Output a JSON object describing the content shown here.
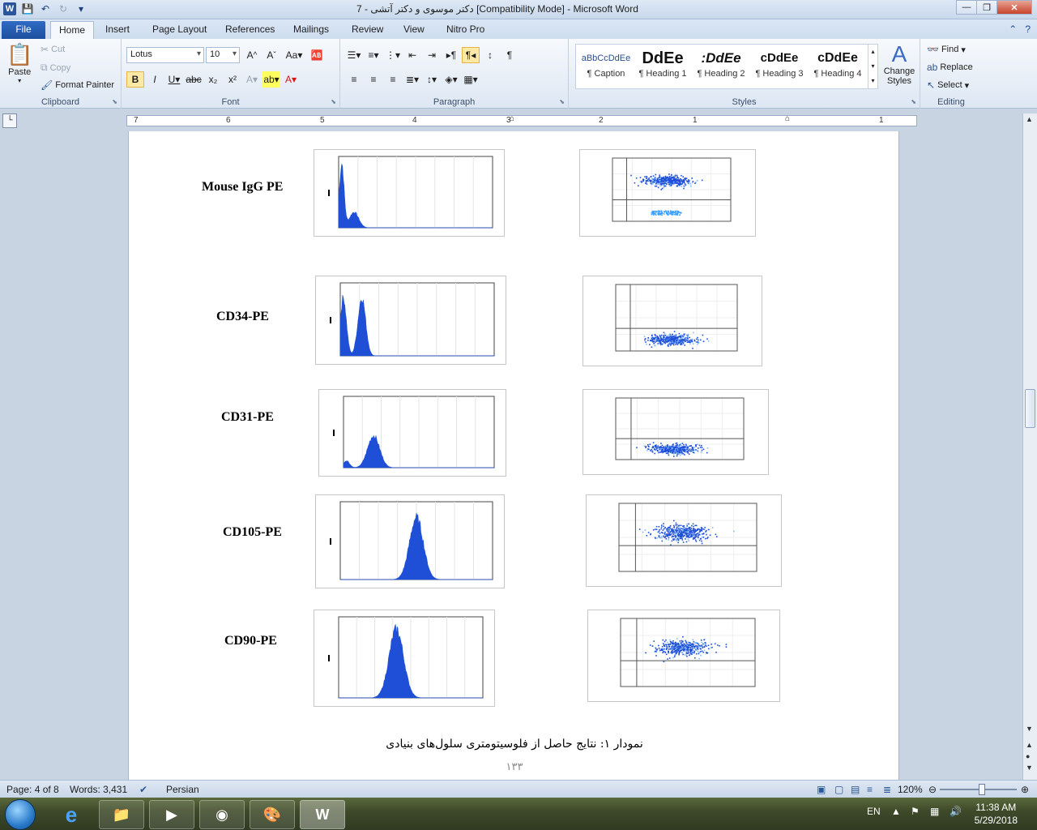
{
  "window": {
    "title": "دکتر موسوی و دکتر آتشی - 7 [Compatibility Mode] - Microsoft Word"
  },
  "quick_access": {
    "icons": [
      "word-logo",
      "save-icon",
      "undo-icon",
      "redo-icon",
      "customize-icon"
    ]
  },
  "tabs": [
    "File",
    "Home",
    "Insert",
    "Page Layout",
    "References",
    "Mailings",
    "Review",
    "View",
    "Nitro Pro"
  ],
  "active_tab": "Home",
  "clipboard": {
    "paste": "Paste",
    "cut": "Cut",
    "copy": "Copy",
    "format_painter": "Format Painter",
    "label": "Clipboard"
  },
  "font": {
    "name": "Lotus",
    "size": "10",
    "label": "Font"
  },
  "paragraph": {
    "label": "Paragraph"
  },
  "styles": {
    "label": "Styles",
    "items": [
      {
        "preview": "aBbCcDdEe",
        "name": "¶ Caption"
      },
      {
        "preview": "DdEe",
        "name": "¶ Heading 1"
      },
      {
        "preview": ":DdEe",
        "name": "¶ Heading 2"
      },
      {
        "preview": "cDdEe",
        "name": "¶ Heading 3"
      },
      {
        "preview": "cDdEe",
        "name": "¶ Heading 4"
      }
    ],
    "change_styles": "Change Styles"
  },
  "editing": {
    "find": "Find",
    "replace": "Replace",
    "select": "Select",
    "label": "Editing"
  },
  "ruler": {
    "numbers": [
      "7",
      "6",
      "5",
      "4",
      "3",
      "2",
      "1",
      "1"
    ]
  },
  "document": {
    "rows": [
      {
        "label": "Mouse IgG PE"
      },
      {
        "label": "CD34-PE"
      },
      {
        "label": "CD31-PE"
      },
      {
        "label": "CD105-PE"
      },
      {
        "label": "CD90-PE"
      }
    ],
    "caption": "نمودار ۱: نتایج حاصل از فلوسیتومتری سلول‌های بنیادی",
    "page_number": "۱۳۳"
  },
  "status": {
    "page": "Page: 4 of 8",
    "words": "Words: 3,431",
    "language": "Persian",
    "zoom": "120%"
  },
  "taskbar": {
    "apps": [
      "ie-icon",
      "explorer-icon",
      "media-player-icon",
      "chrome-icon",
      "paint-icon",
      "word-icon"
    ],
    "lang": "EN",
    "time": "11:38 AM",
    "date": "5/29/2018"
  },
  "colors": {
    "accent": "#2b579a",
    "plot_blue": "#1f4fd6"
  }
}
